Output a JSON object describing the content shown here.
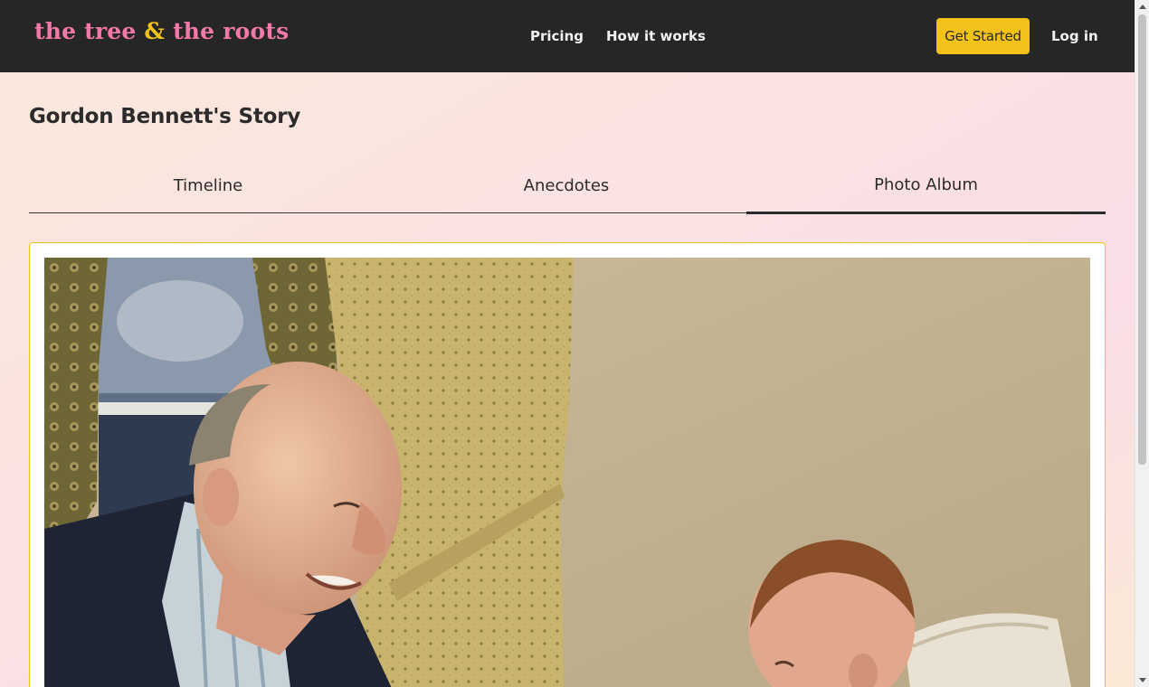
{
  "header": {
    "logo": {
      "part1": "the tree",
      "amp": "&",
      "part2": "the roots"
    },
    "nav": {
      "pricing": "Pricing",
      "how_it_works": "How it works"
    },
    "get_started": "Get Started",
    "login": "Log in"
  },
  "page": {
    "title": "Gordon Bennett's Story"
  },
  "tabs": [
    {
      "label": "Timeline",
      "active": false
    },
    {
      "label": "Anecdotes",
      "active": false
    },
    {
      "label": "Photo Album",
      "active": true
    }
  ],
  "photo_album": {
    "photo_subject": "vintage photo of an older man smiling at a baby"
  },
  "colors": {
    "header_bg": "#262626",
    "logo_pink": "#f279a8",
    "accent_yellow": "#f2c21b"
  }
}
